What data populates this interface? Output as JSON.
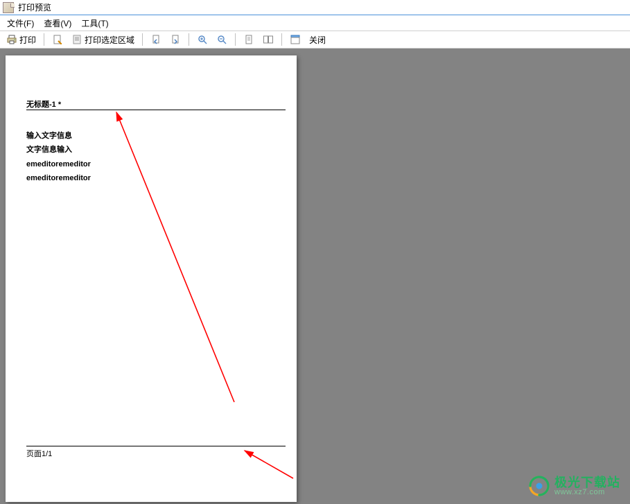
{
  "window": {
    "title": "打印预览"
  },
  "menubar": {
    "items": [
      {
        "label": "文件(F)"
      },
      {
        "label": "查看(V)"
      },
      {
        "label": "工具(T)"
      }
    ]
  },
  "toolbar": {
    "print_label": "打印",
    "print_range_label": "打印选定区域",
    "close_label": "关闭",
    "icons": {
      "printer": "printer-icon",
      "page_setup": "page-setup-icon",
      "page_range": "page-range-icon",
      "page_prev": "page-prev-icon",
      "page_next": "page-next-icon",
      "zoom_in": "zoom-in-icon",
      "zoom_out": "zoom-out-icon",
      "one_page": "one-page-icon",
      "two_page": "two-page-icon",
      "header_footer": "header-footer-icon",
      "close": "close-icon"
    }
  },
  "preview": {
    "header_text": "无标题-1 *",
    "body": [
      "输入文字信息",
      "文字信息输入",
      "emeditoremeditor",
      "emeditoremeditor"
    ],
    "footer_text": "页面1/1"
  },
  "watermark": {
    "main": "极光下载站",
    "sub": "www.xz7.com"
  },
  "colors": {
    "accent_green": "#25b060",
    "titlebar_border": "#4a90d9",
    "content_bg": "#838383",
    "arrow_red": "#ff0000"
  }
}
